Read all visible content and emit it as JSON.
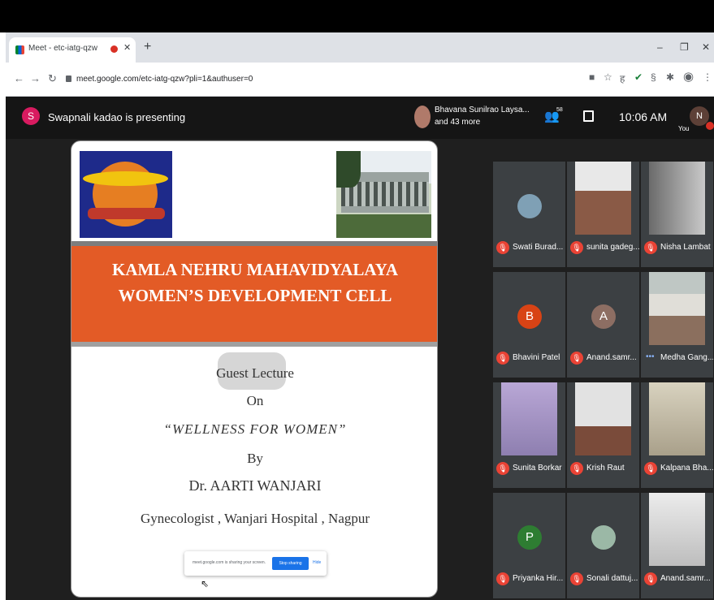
{
  "browser": {
    "tab_title": "Meet - etc-iatg-qzw",
    "url": "meet.google.com/etc-iatg-qzw?pli=1&authuser=0"
  },
  "meet": {
    "presenting_avatar": "S",
    "presenting_text": "Swapnali kadao is presenting",
    "participants_line1": "Bhavana Sunilrao Laysa...",
    "participants_line2": "and 43 more",
    "people_count": "58",
    "time": "10:06 AM",
    "self_avatar": "N",
    "self_label": "You"
  },
  "slide": {
    "college_line1": "KAMLA  NEHRU MAHAVIDYALAYA",
    "college_line2": "WOMEN’S DEVELOPMENT CELL",
    "guest_lecture": "Guest Lecture",
    "on": "On",
    "topic": "“WELLNESS FOR WOMEN”",
    "by": "By",
    "speaker": "Dr. AARTI  WANJARI",
    "role": "Gynecologist , Wanjari Hospital , Nagpur"
  },
  "share_bar": {
    "message": "meet.google.com is sharing your screen.",
    "stop_label": "Stop sharing",
    "hide_label": "Hide"
  },
  "tiles": [
    {
      "name": "Swati Burad..."
    },
    {
      "name": "sunita gadeg..."
    },
    {
      "name": "Nisha Lambat"
    },
    {
      "name": "Bhavini Patel",
      "avatar": "B"
    },
    {
      "name": "Anand.samr...",
      "avatar": "A"
    },
    {
      "name": "Medha Gang..."
    },
    {
      "name": "Sunita Borkar"
    },
    {
      "name": "Krish Raut"
    },
    {
      "name": "Kalpana Bha..."
    },
    {
      "name": "Priyanka Hir...",
      "avatar": "P"
    },
    {
      "name": "Sonali dattuj..."
    },
    {
      "name": "Anand.samr..."
    }
  ],
  "colors": {
    "accent": "#1a73e8",
    "banner": "#e35b26",
    "mic_off": "#ea4335"
  }
}
